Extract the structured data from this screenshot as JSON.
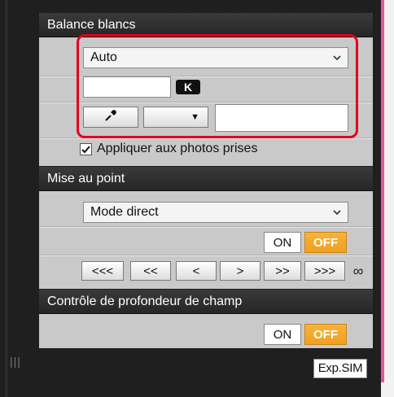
{
  "white_balance": {
    "title": "Balance blancs",
    "mode_value": "Auto",
    "kelvin_value": "",
    "kelvin_badge": "K",
    "eyedropper_icon": "eyedropper-icon",
    "dropdown_arrow": "▼",
    "custom_value": "",
    "apply_checked": true,
    "apply_label": "Appliquer aux photos prises"
  },
  "focus": {
    "title": "Mise au point",
    "mode_value": "Mode direct",
    "on_label": "ON",
    "off_label": "OFF",
    "nav_buttons": [
      "<<<",
      "<<",
      "<",
      ">",
      ">>",
      ">>>"
    ],
    "infinity_symbol": "∞"
  },
  "dof": {
    "title": "Contrôle de profondeur de champ",
    "on_label": "ON",
    "off_label": "OFF"
  },
  "footer": {
    "handle_glyph": "|||",
    "exp_sim_label": "Exp.SIM"
  },
  "colors": {
    "highlight": "#e3001b",
    "off_active": "#f0a020",
    "side_accent": "#e8549b"
  }
}
